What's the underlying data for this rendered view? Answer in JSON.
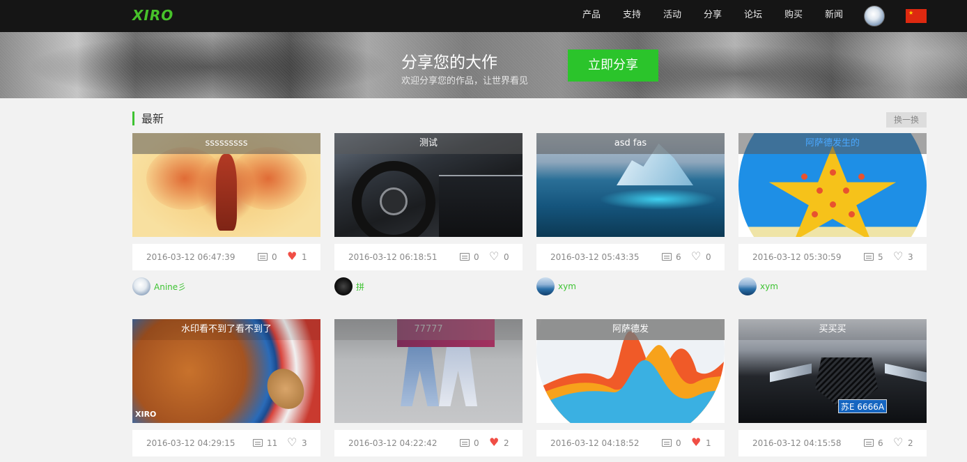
{
  "header": {
    "logo": "XIRO",
    "nav": [
      "产品",
      "支持",
      "活动",
      "分享",
      "论坛",
      "购买",
      "新闻"
    ]
  },
  "banner": {
    "title": "分享您的大作",
    "subtitle": "欢迎分享您的作品，让世界看见",
    "button": "立即分享"
  },
  "section": {
    "title": "最新",
    "refresh": "换一换"
  },
  "cards": [
    {
      "title": "sssssssss",
      "date": "2016-03-12 06:47:39",
      "comments": "0",
      "likes": "1",
      "liked": true,
      "author": "Anine彡"
    },
    {
      "title": "测试",
      "date": "2016-03-12 06:18:51",
      "comments": "0",
      "likes": "0",
      "liked": false,
      "author": "拼"
    },
    {
      "title": "asd fas",
      "date": "2016-03-12 05:43:35",
      "comments": "6",
      "likes": "0",
      "liked": false,
      "author": "xym"
    },
    {
      "title": "阿萨德发生的",
      "date": "2016-03-12 05:30:59",
      "comments": "5",
      "likes": "3",
      "liked": false,
      "author": "xym"
    },
    {
      "title": "水印看不到了看不到了",
      "date": "2016-03-12 04:29:15",
      "comments": "11",
      "likes": "3",
      "liked": false,
      "watermark": "XIRO"
    },
    {
      "title": "77777",
      "date": "2016-03-12 04:22:42",
      "comments": "0",
      "likes": "2",
      "liked": true
    },
    {
      "title": "阿萨德发",
      "date": "2016-03-12 04:18:52",
      "comments": "0",
      "likes": "1",
      "liked": true
    },
    {
      "title": "买买买",
      "date": "2016-03-12 04:15:58",
      "comments": "6",
      "likes": "2",
      "liked": false,
      "plate": "苏E 6666A"
    }
  ],
  "colors": {
    "brand_green": "#3ec332",
    "button_green": "#2bc42b",
    "like_red": "#f04e45",
    "topbar": "#151515"
  }
}
